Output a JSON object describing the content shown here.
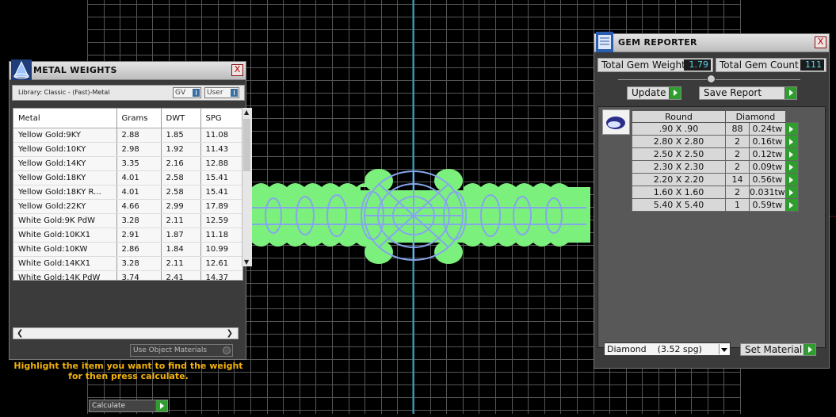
{
  "metal_weights": {
    "title": "METAL WEIGHTS",
    "close": "X",
    "library_label": "Library: Classic - (Fast)-Metal",
    "gv_label": "GV",
    "user_label": "User",
    "columns": [
      "Metal",
      "Grams",
      "DWT",
      "SPG"
    ],
    "rows": [
      [
        "Yellow Gold:9KY",
        "2.88",
        "1.85",
        "11.08"
      ],
      [
        "Yellow Gold:10KY",
        "2.98",
        "1.92",
        "11.43"
      ],
      [
        "Yellow Gold:14KY",
        "3.35",
        "2.16",
        "12.88"
      ],
      [
        "Yellow Gold:18KY",
        "4.01",
        "2.58",
        "15.41"
      ],
      [
        "Yellow Gold:18KY R...",
        "4.01",
        "2.58",
        "15.41"
      ],
      [
        "Yellow Gold:22KY",
        "4.66",
        "2.99",
        "17.89"
      ],
      [
        "White Gold:9K PdW",
        "3.28",
        "2.11",
        "12.59"
      ],
      [
        "White Gold:10KX1",
        "2.91",
        "1.87",
        "11.18"
      ],
      [
        "White Gold:10KW",
        "2.86",
        "1.84",
        "10.99"
      ],
      [
        "White Gold:14KX1",
        "3.28",
        "2.11",
        "12.61"
      ],
      [
        "White Gold:14K PdW",
        "3.74",
        "2.41",
        "14.37"
      ]
    ],
    "use_object_materials": "Use Object Materials",
    "hint": "Highlight the item you want to find the weight for then press calculate.",
    "calculate": "Calculate"
  },
  "gem_reporter": {
    "title": "GEM REPORTER",
    "close": "X",
    "total_gem_weight_label": "Total Gem Weight",
    "total_gem_weight_value": "1.79",
    "total_gem_count_label": "Total Gem Count",
    "total_gem_count_value": "111",
    "update_label": "Update",
    "save_report_label": "Save Report",
    "shape_header": "Round",
    "material_header": "Diamond",
    "gems": [
      {
        "size": ".90 X .90",
        "count": "88",
        "weight": "0.24tw"
      },
      {
        "size": "2.80 X 2.80",
        "count": "2",
        "weight": "0.16tw"
      },
      {
        "size": "2.50 X 2.50",
        "count": "2",
        "weight": "0.12tw"
      },
      {
        "size": "2.30 X 2.30",
        "count": "2",
        "weight": "0.09tw"
      },
      {
        "size": "2.20 X 2.20",
        "count": "14",
        "weight": "0.56tw"
      },
      {
        "size": "1.60 X 1.60",
        "count": "2",
        "weight": "0.031tw"
      },
      {
        "size": "5.40 X 5.40",
        "count": "1",
        "weight": "0.59tw"
      }
    ],
    "material_select": "Diamond    (3.52 spg)",
    "set_material_label": "Set Material"
  },
  "colors": {
    "viewport_bg": "#000000",
    "grid": "#5a5a5a",
    "axis_cyan": "#2ea6c0",
    "ring_green": "#7cf07c",
    "ring_blue": "#86a6ec",
    "hint_text": "#f2b20c",
    "value_text": "#55d4ec"
  }
}
